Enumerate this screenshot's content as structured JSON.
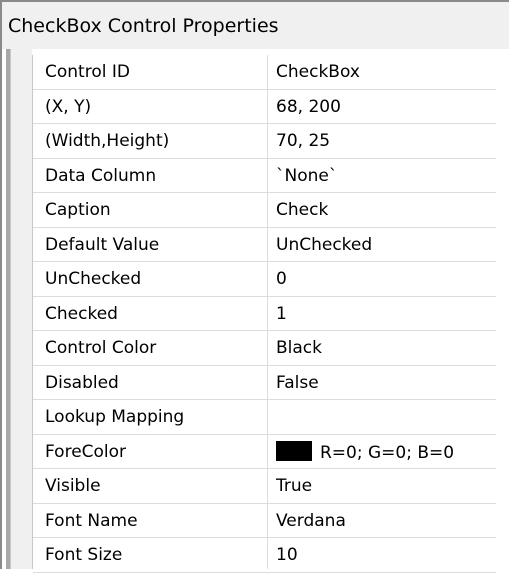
{
  "title": "CheckBox Control Properties",
  "properties": [
    {
      "name": "Control ID",
      "value": "CheckBox"
    },
    {
      "name": "(X, Y)",
      "value": "68, 200"
    },
    {
      "name": "(Width,Height)",
      "value": "70, 25"
    },
    {
      "name": "Data Column",
      "value": "`None`"
    },
    {
      "name": "Caption",
      "value": "Check"
    },
    {
      "name": "Default Value",
      "value": "UnChecked"
    },
    {
      "name": "UnChecked",
      "value": "0"
    },
    {
      "name": "Checked",
      "value": "1"
    },
    {
      "name": "Control Color",
      "value": "Black"
    },
    {
      "name": "Disabled",
      "value": "False"
    },
    {
      "name": "Lookup Mapping",
      "value": ""
    },
    {
      "name": "ForeColor",
      "value": "R=0; G=0; B=0",
      "swatch_color": "#000000"
    },
    {
      "name": "Visible",
      "value": "True"
    },
    {
      "name": "Font Name",
      "value": "Verdana"
    },
    {
      "name": "Font Size",
      "value": "10"
    }
  ]
}
